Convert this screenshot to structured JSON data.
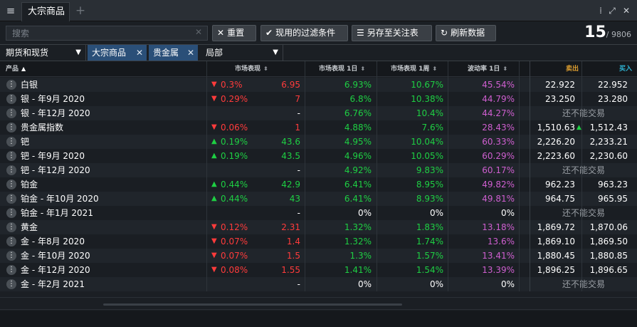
{
  "window": {
    "tab_title": "大宗商品",
    "tab_add": "+",
    "menu_icon": "≡",
    "expand_icon": "⤢",
    "close_icon": "✕",
    "more_icon": "⁞"
  },
  "toolbar": {
    "search_placeholder": "搜索",
    "search_clear": "✕",
    "reset_label": "重置",
    "reset_icon": "✕",
    "filters_label": "现用的过滤条件",
    "filters_icon": "✔",
    "save_label": "另存至关注表",
    "save_icon": "☰",
    "refresh_label": "刷新数据",
    "refresh_icon": "↻",
    "count_shown": "15",
    "count_total": "/ 9806"
  },
  "filters": {
    "type_select": "期货和现货",
    "chips": [
      "大宗商品",
      "贵金属"
    ],
    "chip_close": "✕",
    "scope_select": "局部",
    "caret": "▼"
  },
  "columns": {
    "product": "产品",
    "product_sort": "▲",
    "market": "市场表现",
    "market_1d": "市场表现 1日",
    "market_1w": "市场表现 1周",
    "volatility_1d": "波动率 1日",
    "sort_icon": "⬍",
    "sell": "卖出",
    "buy": "买入"
  },
  "colors": {
    "up": "#1ecf43",
    "down": "#ff3b3b",
    "volatility": "#cf5fd0",
    "sell_header": "#e0a030",
    "buy_header": "#2fb6d6",
    "chip": "#2a4f78"
  },
  "rows": [
    {
      "name": "白银",
      "dir": "down",
      "chg_pct": "0.3%",
      "chg": "6.95",
      "d1": "6.93%",
      "w1": "10.67%",
      "vol": "45.54%",
      "sell": "22.922",
      "buy": "22.952",
      "status": ""
    },
    {
      "name": "银 - 年9月 2020",
      "dir": "down",
      "chg_pct": "0.29%",
      "chg": "7",
      "d1": "6.8%",
      "w1": "10.38%",
      "vol": "44.79%",
      "sell": "23.250",
      "buy": "23.280",
      "status": ""
    },
    {
      "name": "银 - 年12月 2020",
      "dir": "",
      "chg_pct": "",
      "chg": "-",
      "d1": "6.76%",
      "w1": "10.4%",
      "vol": "44.27%",
      "sell": "",
      "buy": "",
      "status": "还不能交易"
    },
    {
      "name": "贵金属指数",
      "dir": "down",
      "chg_pct": "0.06%",
      "chg": "1",
      "d1": "4.88%",
      "w1": "7.6%",
      "vol": "28.43%",
      "sell": "1,510.63",
      "buy": "1,512.43",
      "status": "",
      "tick": "▲"
    },
    {
      "name": "钯",
      "dir": "up",
      "chg_pct": "0.19%",
      "chg": "43.6",
      "d1": "4.95%",
      "w1": "10.04%",
      "vol": "60.33%",
      "sell": "2,226.20",
      "buy": "2,233.21",
      "status": ""
    },
    {
      "name": "钯 - 年9月 2020",
      "dir": "up",
      "chg_pct": "0.19%",
      "chg": "43.5",
      "d1": "4.96%",
      "w1": "10.05%",
      "vol": "60.29%",
      "sell": "2,223.60",
      "buy": "2,230.60",
      "status": ""
    },
    {
      "name": "钯 - 年12月 2020",
      "dir": "",
      "chg_pct": "",
      "chg": "-",
      "d1": "4.92%",
      "w1": "9.83%",
      "vol": "60.17%",
      "sell": "",
      "buy": "",
      "status": "还不能交易"
    },
    {
      "name": "铂金",
      "dir": "up",
      "chg_pct": "0.44%",
      "chg": "42.9",
      "d1": "6.41%",
      "w1": "8.95%",
      "vol": "49.82%",
      "sell": "962.23",
      "buy": "963.23",
      "status": ""
    },
    {
      "name": "铂金 - 年10月 2020",
      "dir": "up",
      "chg_pct": "0.44%",
      "chg": "43",
      "d1": "6.41%",
      "w1": "8.93%",
      "vol": "49.81%",
      "sell": "964.75",
      "buy": "965.95",
      "status": ""
    },
    {
      "name": "铂金 - 年1月 2021",
      "dir": "",
      "chg_pct": "",
      "chg": "-",
      "d1": "0%",
      "w1": "0%",
      "vol": "0%",
      "sell": "",
      "buy": "",
      "status": "还不能交易"
    },
    {
      "name": "黄金",
      "dir": "down",
      "chg_pct": "0.12%",
      "chg": "2.31",
      "d1": "1.32%",
      "w1": "1.83%",
      "vol": "13.18%",
      "sell": "1,869.72",
      "buy": "1,870.06",
      "status": ""
    },
    {
      "name": "金 - 年8月 2020",
      "dir": "down",
      "chg_pct": "0.07%",
      "chg": "1.4",
      "d1": "1.32%",
      "w1": "1.74%",
      "vol": "13.6%",
      "sell": "1,869.10",
      "buy": "1,869.50",
      "status": ""
    },
    {
      "name": "金 - 年10月 2020",
      "dir": "down",
      "chg_pct": "0.07%",
      "chg": "1.5",
      "d1": "1.3%",
      "w1": "1.57%",
      "vol": "13.41%",
      "sell": "1,880.45",
      "buy": "1,880.85",
      "status": ""
    },
    {
      "name": "金 - 年12月 2020",
      "dir": "down",
      "chg_pct": "0.08%",
      "chg": "1.55",
      "d1": "1.41%",
      "w1": "1.54%",
      "vol": "13.39%",
      "sell": "1,896.25",
      "buy": "1,896.65",
      "status": ""
    },
    {
      "name": "金 - 年2月 2021",
      "dir": "",
      "chg_pct": "",
      "chg": "-",
      "d1": "0%",
      "w1": "0%",
      "vol": "0%",
      "sell": "",
      "buy": "",
      "status": "还不能交易"
    }
  ]
}
